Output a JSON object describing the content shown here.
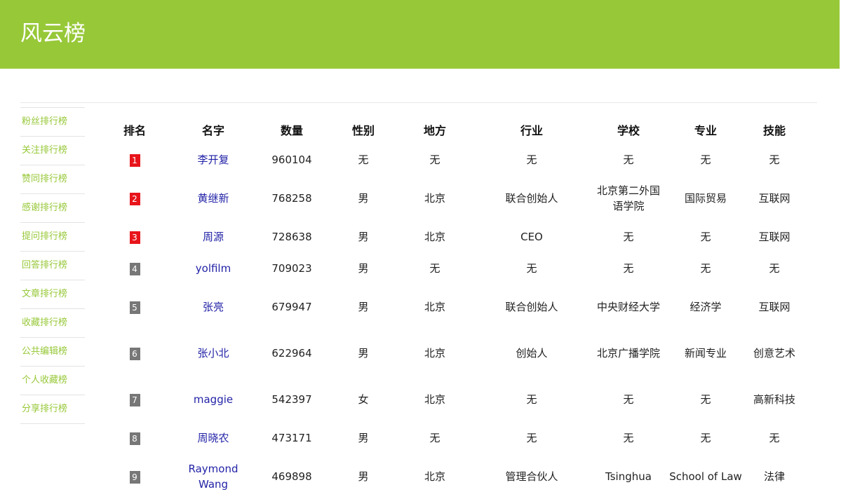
{
  "header": {
    "title": "风云榜"
  },
  "sidebar": {
    "items": [
      {
        "label": "粉丝排行榜"
      },
      {
        "label": "关注排行榜"
      },
      {
        "label": "赞同排行榜"
      },
      {
        "label": "感谢排行榜"
      },
      {
        "label": "提问排行榜"
      },
      {
        "label": "回答排行榜"
      },
      {
        "label": "文章排行榜"
      },
      {
        "label": "收藏排行榜"
      },
      {
        "label": "公共编辑榜"
      },
      {
        "label": "个人收藏榜"
      },
      {
        "label": "分享排行榜"
      }
    ]
  },
  "table": {
    "headers": [
      "排名",
      "名字",
      "数量",
      "性别",
      "地方",
      "行业",
      "学校",
      "专业",
      "技能"
    ],
    "rows": [
      {
        "rank": "1",
        "name": "李开复",
        "count": "960104",
        "gender": "无",
        "place": "无",
        "industry": "无",
        "school": "无",
        "major": "无",
        "skill": "无"
      },
      {
        "rank": "2",
        "name": "黄继新",
        "count": "768258",
        "gender": "男",
        "place": "北京",
        "industry": "联合创始人",
        "school": "北京第二外国语学院",
        "major": "国际贸易",
        "skill": "互联网"
      },
      {
        "rank": "3",
        "name": "周源",
        "count": "728638",
        "gender": "男",
        "place": "北京",
        "industry": "CEO",
        "school": "无",
        "major": "无",
        "skill": "互联网"
      },
      {
        "rank": "4",
        "name": "yolfilm",
        "count": "709023",
        "gender": "男",
        "place": "无",
        "industry": "无",
        "school": "无",
        "major": "无",
        "skill": "无"
      },
      {
        "rank": "5",
        "name": "张亮",
        "count": "679947",
        "gender": "男",
        "place": "北京",
        "industry": "联合创始人",
        "school": "中央财经大学",
        "major": "经济学",
        "skill": "互联网"
      },
      {
        "rank": "6",
        "name": "张小北",
        "count": "622964",
        "gender": "男",
        "place": "北京",
        "industry": "创始人",
        "school": "北京广播学院",
        "major": "新闻专业",
        "skill": "创意艺术"
      },
      {
        "rank": "7",
        "name": "maggie",
        "count": "542397",
        "gender": "女",
        "place": "北京",
        "industry": "无",
        "school": "无",
        "major": "无",
        "skill": "高新科技"
      },
      {
        "rank": "8",
        "name": "周晓农",
        "count": "473171",
        "gender": "男",
        "place": "无",
        "industry": "无",
        "school": "无",
        "major": "无",
        "skill": "无"
      },
      {
        "rank": "9",
        "name": "Raymond Wang",
        "count": "469898",
        "gender": "男",
        "place": "北京",
        "industry": "管理合伙人",
        "school": "Tsinghua",
        "major": "School of Law",
        "skill": "法律"
      }
    ]
  },
  "colors": {
    "accent": "#97c838",
    "badge_top": "#e8141b",
    "badge_rest": "#777777",
    "link": "#2323a8"
  }
}
